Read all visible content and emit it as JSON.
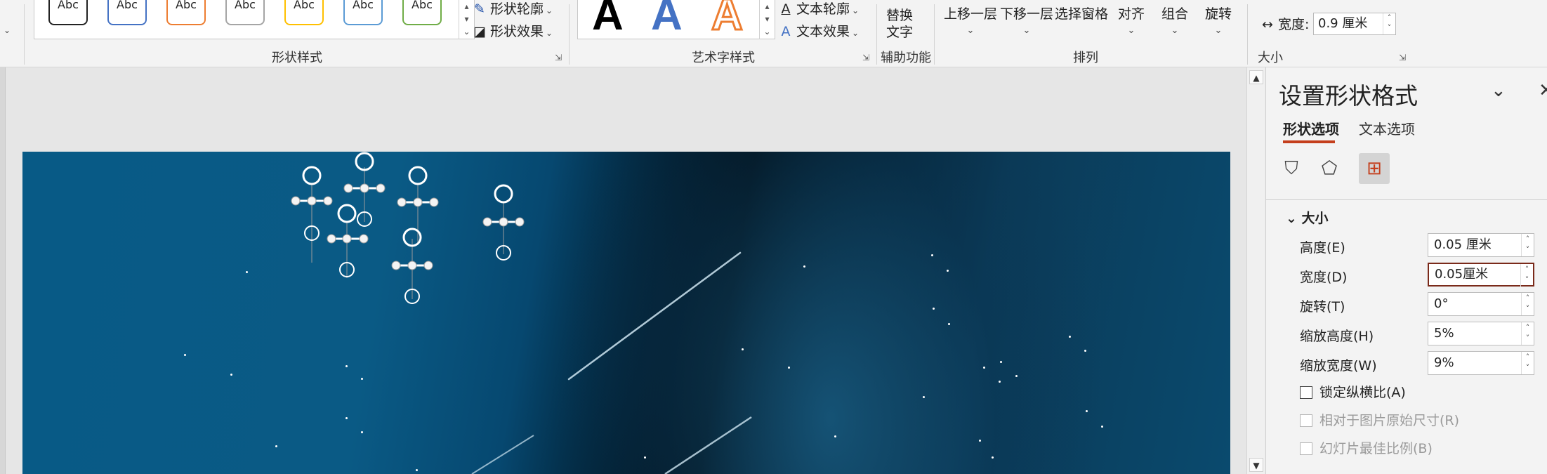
{
  "ribbon": {
    "shape_styles": {
      "swatches": [
        {
          "label": "Abc",
          "color": "#222222"
        },
        {
          "label": "Abc",
          "color": "#4472c4"
        },
        {
          "label": "Abc",
          "color": "#ed7d31"
        },
        {
          "label": "Abc",
          "color": "#a5a5a5"
        },
        {
          "label": "Abc",
          "color": "#ffc000"
        },
        {
          "label": "Abc",
          "color": "#5b9bd5"
        },
        {
          "label": "Abc",
          "color": "#70ad47"
        }
      ],
      "outline_label": "形状轮廓",
      "effects_label": "形状效果",
      "group_label": "形状样式"
    },
    "wordart": {
      "letters": [
        {
          "text": "A",
          "color": "#000000"
        },
        {
          "text": "A",
          "color": "#4472c4"
        },
        {
          "text": "A",
          "color": "#ed7d31"
        }
      ],
      "outline_label": "文本轮廓",
      "effects_label": "文本效果",
      "group_label": "艺术字样式"
    },
    "accessibility": {
      "alt_text_line1": "替换",
      "alt_text_line2": "文字",
      "group_label": "辅助功能"
    },
    "arrange": {
      "bring_forward": "上移一层",
      "send_backward": "下移一层",
      "selection_pane": "选择窗格",
      "align": "对齐",
      "group": "组合",
      "rotate": "旋转",
      "group_label": "排列"
    },
    "size": {
      "width_label": "宽度:",
      "width_value": "0.9 厘米",
      "group_label": "大小"
    }
  },
  "pane": {
    "title": "设置形状格式",
    "tabs": [
      "形状选项",
      "文本选项"
    ],
    "section": "大小",
    "fields": [
      {
        "label": "高度(E)",
        "value": "0.05 厘米"
      },
      {
        "label": "宽度(D)",
        "value": "0.05厘米"
      },
      {
        "label": "旋转(T)",
        "value": "0°"
      },
      {
        "label": "缩放高度(H)",
        "value": "5%"
      },
      {
        "label": "缩放宽度(W)",
        "value": "9%"
      }
    ],
    "checkboxes": [
      {
        "label": "锁定纵横比(A)",
        "checked": false,
        "enabled": true
      },
      {
        "label": "相对于图片原始尺寸(R)",
        "checked": false,
        "enabled": false
      },
      {
        "label": "幻灯片最佳比例(B)",
        "checked": false,
        "enabled": false
      }
    ]
  },
  "colors": {
    "accent": "#c43e1c",
    "slide_blue": "#0a5a85"
  }
}
